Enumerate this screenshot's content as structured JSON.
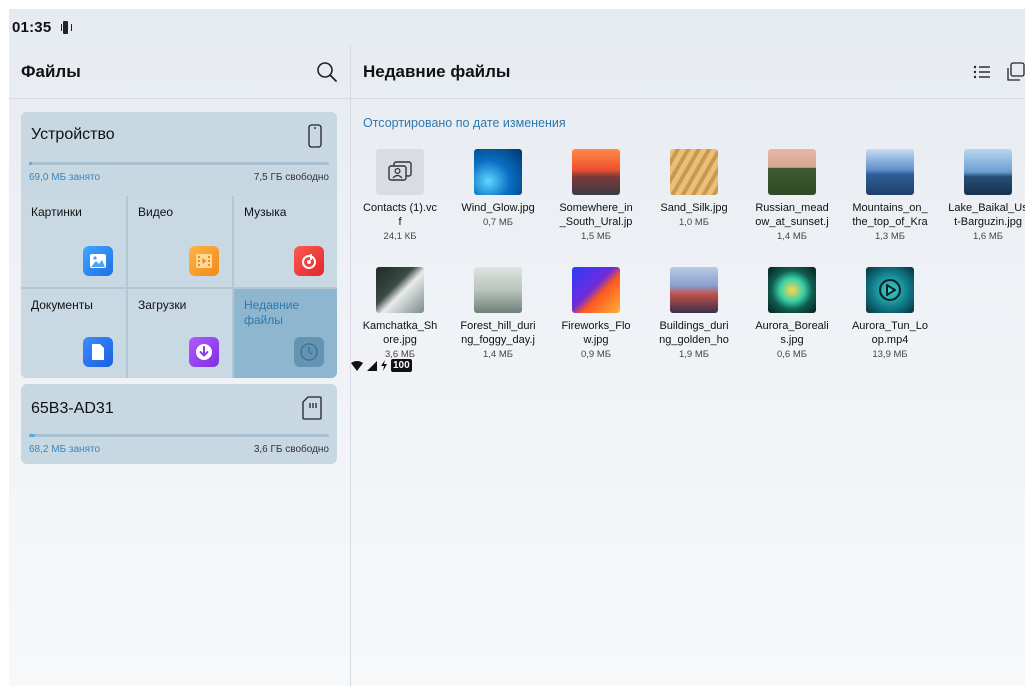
{
  "status": {
    "time": "01:35",
    "battery": "100"
  },
  "left": {
    "title": "Файлы",
    "device": {
      "name": "Устройство",
      "used": "69,0 МБ занято",
      "free": "7,5 ГБ свободно",
      "used_fraction": 0.01
    },
    "categories": [
      {
        "label": "Картинки"
      },
      {
        "label": "Видео"
      },
      {
        "label": "Музыка"
      },
      {
        "label": "Документы"
      },
      {
        "label": "Загрузки"
      },
      {
        "label": "Недавние файлы"
      }
    ],
    "sd": {
      "name": "65B3-AD31",
      "used": "68,2 МБ занято",
      "free": "3,6 ГБ свободно",
      "used_fraction": 0.02
    }
  },
  "right": {
    "title": "Недавние файлы",
    "sort_label": "Отсортировано по дате изменения",
    "files": [
      {
        "name": "Contacts (1).vcf",
        "size": "24,1 КБ",
        "thumb": "contact-icon"
      },
      {
        "name": "Wind_Glow.jpg",
        "size": "0,7 МБ",
        "thumb": "wave-blue"
      },
      {
        "name": "Somewhere_in_South_Ural.jpg",
        "size": "1,5 МБ",
        "thumb": "sunset-mountain"
      },
      {
        "name": "Sand_Silk.jpg",
        "size": "1,0 МБ",
        "thumb": "sand"
      },
      {
        "name": "Russian_meadow_at_sunset.jpg",
        "size": "1,4 МБ",
        "thumb": "meadow"
      },
      {
        "name": "Mountains_on_the_top_of_Krasnaya",
        "size": "1,3 МБ",
        "thumb": "blue-mountains"
      },
      {
        "name": "Lake_Baikal_Ust-Barguzin.jpg",
        "size": "1,6 МБ",
        "thumb": "lake"
      },
      {
        "name": "Kamchatka_Shore.jpg",
        "size": "3,6 МБ",
        "thumb": "shore"
      },
      {
        "name": "Forest_hill_during_foggy_day.jpg",
        "size": "1,4 МБ",
        "thumb": "fog"
      },
      {
        "name": "Fireworks_Flow.jpg",
        "size": "0,9 МБ",
        "thumb": "fireworks"
      },
      {
        "name": "Buildings_during_golden_hour",
        "size": "1,9 МБ",
        "thumb": "city"
      },
      {
        "name": "Aurora_Borealis.jpg",
        "size": "0,6 МБ",
        "thumb": "aurora"
      },
      {
        "name": "Aurora_Tun_Loop.mp4",
        "size": "13,9 МБ",
        "thumb": "video"
      }
    ],
    "file_name_display": [
      "Contacts (1).vc\nf",
      "Wind_Glow.jpg",
      "Somewhere_in\n_South_Ural.jp",
      "Sand_Silk.jpg",
      "Russian_mead\now_at_sunset.j",
      "Mountains_on_\nthe_top_of_Kra",
      "Lake_Baikal_Us\nt-Barguzin.jpg",
      "Kamchatka_Sh\nore.jpg",
      "Forest_hill_duri\nng_foggy_day.j",
      "Fireworks_Flo\nw.jpg",
      "Buildings_duri\nng_golden_ho",
      "Aurora_Boreali\ns.jpg",
      "Aurora_Tun_Lo\nop.mp4"
    ]
  },
  "colors": {
    "accent": "#2f78ad",
    "progress": "#57a8db",
    "card": "#c7d8e3"
  }
}
